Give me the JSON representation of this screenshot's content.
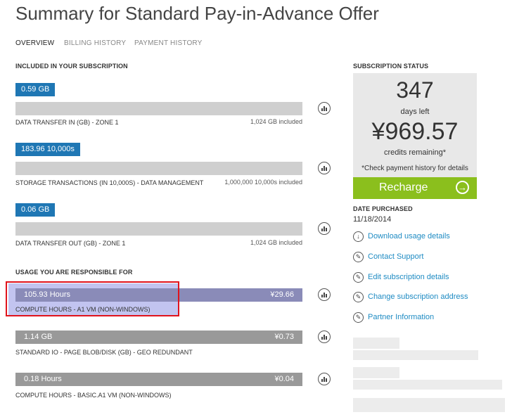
{
  "page_title": "Summary for Standard Pay-in-Advance Offer",
  "tabs": [
    {
      "label": "OVERVIEW",
      "active": true
    },
    {
      "label": "BILLING HISTORY",
      "active": false
    },
    {
      "label": "PAYMENT HISTORY",
      "active": false
    }
  ],
  "included": {
    "heading": "INCLUDED IN YOUR SUBSCRIPTION",
    "items": [
      {
        "value": "0.59 GB",
        "label": "DATA TRANSFER IN (GB) - ZONE 1",
        "included": "1,024 GB included"
      },
      {
        "value": "183.96 10,000s",
        "label": "STORAGE TRANSACTIONS (IN 10,000S) - DATA MANAGEMENT",
        "included": "1,000,000 10,000s included"
      },
      {
        "value": "0.06 GB",
        "label": "DATA TRANSFER OUT (GB) - ZONE 1",
        "included": "1,024 GB included"
      }
    ]
  },
  "usage": {
    "heading": "USAGE YOU ARE RESPONSIBLE FOR",
    "items": [
      {
        "value": "105.93 Hours",
        "cost": "¥29.66",
        "label": "COMPUTE HOURS - A1 VM (NON-WINDOWS)"
      },
      {
        "value": "1.14 GB",
        "cost": "¥0.73",
        "label": "STANDARD IO - PAGE BLOB/DISK (GB) - GEO REDUNDANT"
      },
      {
        "value": "0.18 Hours",
        "cost": "¥0.04",
        "label": "COMPUTE HOURS - BASIC.A1 VM (NON-WINDOWS)"
      }
    ]
  },
  "status": {
    "heading": "SUBSCRIPTION STATUS",
    "days": "347",
    "days_label": "days left",
    "credits": "¥969.57",
    "credits_label": "credits remaining*",
    "note": "*Check payment history for details",
    "recharge_label": "Recharge"
  },
  "date_purchased": {
    "heading": "DATE PURCHASED",
    "value": "11/18/2014"
  },
  "links": [
    {
      "label": "Download usage details",
      "icon": "download-icon"
    },
    {
      "label": "Contact Support",
      "icon": "pencil-icon"
    },
    {
      "label": "Edit subscription details",
      "icon": "pencil-icon"
    },
    {
      "label": "Change subscription address",
      "icon": "pencil-icon"
    },
    {
      "label": "Partner Information",
      "icon": "pencil-icon"
    }
  ],
  "colors": {
    "accent_blue": "#1f77b4",
    "recharge_green": "#8bbf1d",
    "link_blue": "#1e8bc3",
    "highlight_red": "#e0131c"
  }
}
